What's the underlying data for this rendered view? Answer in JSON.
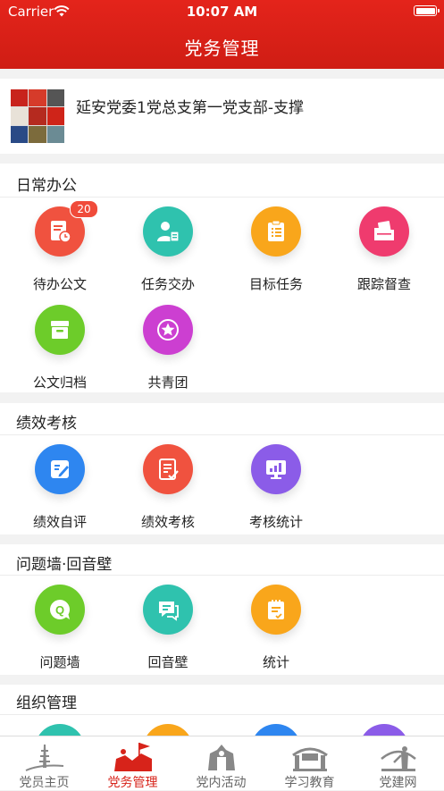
{
  "status_bar": {
    "carrier": "Carrier",
    "time": "10:07 AM"
  },
  "header": {
    "title": "党务管理"
  },
  "org": {
    "name": "延安党委1党总支第一党支部-支撑"
  },
  "sections": [
    {
      "title": "日常办公",
      "items": [
        {
          "label": "待办公文",
          "icon": "document-clock-icon",
          "color": "#f0523f",
          "badge": "20"
        },
        {
          "label": "任务交办",
          "icon": "user-assign-icon",
          "color": "#2fc2ae"
        },
        {
          "label": "目标任务",
          "icon": "clipboard-list-icon",
          "color": "#f9a61b"
        },
        {
          "label": "跟踪督查",
          "icon": "folder-icon",
          "color": "#ef3b6e"
        },
        {
          "label": "公文归档",
          "icon": "archive-box-icon",
          "color": "#6dcc2a"
        },
        {
          "label": "共青团",
          "icon": "star-badge-icon",
          "color": "#cc3fd1"
        }
      ]
    },
    {
      "title": "绩效考核",
      "items": [
        {
          "label": "绩效自评",
          "icon": "edit-form-icon",
          "color": "#2e86f0"
        },
        {
          "label": "绩效考核",
          "icon": "checklist-icon",
          "color": "#f0523f"
        },
        {
          "label": "考核统计",
          "icon": "chart-board-icon",
          "color": "#8b5ce8"
        }
      ]
    },
    {
      "title": "问题墙·回音壁",
      "items": [
        {
          "label": "问题墙",
          "icon": "question-bubble-icon",
          "color": "#6dcc2a"
        },
        {
          "label": "回音壁",
          "icon": "chat-bubble-icon",
          "color": "#2fc2ae"
        },
        {
          "label": "统计",
          "icon": "stats-clipboard-icon",
          "color": "#f9a61b"
        }
      ]
    },
    {
      "title": "组织管理",
      "items": []
    }
  ],
  "tabs": [
    {
      "label": "党员主页",
      "icon": "pagoda-icon",
      "active": false
    },
    {
      "label": "党务管理",
      "icon": "flag-bearers-icon",
      "active": true
    },
    {
      "label": "党内活动",
      "icon": "monument-icon",
      "active": false
    },
    {
      "label": "学习教育",
      "icon": "gate-icon",
      "active": false
    },
    {
      "label": "党建网",
      "icon": "statue-icon",
      "active": false
    }
  ],
  "colors": {
    "brand_red": "#d7231a",
    "partial_row": [
      "#2fc2ae",
      "#f9a61b",
      "#2e86f0",
      "#8b5ce8"
    ]
  }
}
